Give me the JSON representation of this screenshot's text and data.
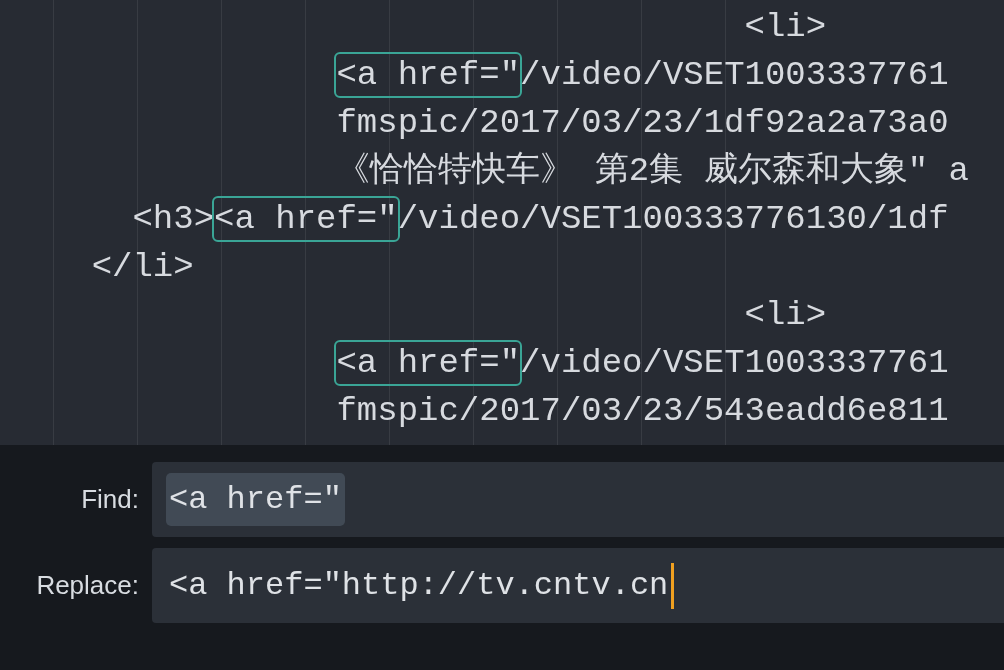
{
  "editor": {
    "lines": [
      {
        "before": "                                    <li>"
      },
      {
        "match": "                <a href=\"",
        "after": "/video/VSET1003337761"
      },
      {
        "before": "                fmspic/2017/03/23/1df92a2a73a0"
      },
      {
        "before": "                《恰恰特快车》 第2集 威尔森和大象\" a"
      },
      {
        "before": "      <h3>",
        "match": "<a href=\"",
        "after": "/video/VSET100333776130/1df"
      },
      {
        "before": "    </li>"
      },
      {
        "before": "                                    <li>"
      },
      {
        "match": "                <a href=\"",
        "after": "/video/VSET1003337761"
      },
      {
        "before": "                fmspic/2017/03/23/543eadd6e811"
      }
    ]
  },
  "find_panel": {
    "fields": [
      {
        "label": "Find:",
        "value": "<a href=\"",
        "selected": true,
        "focused": false
      },
      {
        "label": "Replace:",
        "value": "<a href=\"http://tv.cntv.cn",
        "selected": false,
        "focused": true
      }
    ]
  }
}
